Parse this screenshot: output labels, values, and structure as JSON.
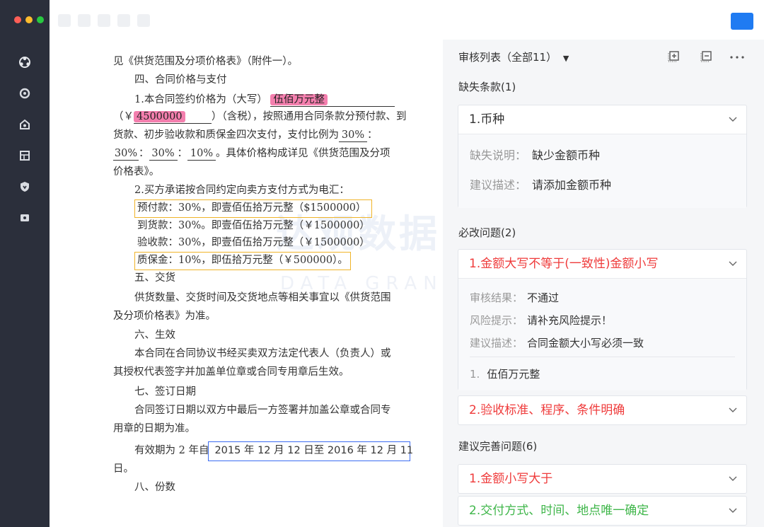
{
  "colors": {
    "sidebar": "#2b2f3b",
    "accent_blue": "#1f7bf2",
    "red": "#ef3b3b",
    "green": "#3fb64a",
    "highlight_pink": "#f47fae",
    "box_yellow": "#f0b429",
    "box_blue": "#3d6df2"
  },
  "sidebar": {
    "icons": [
      "logo-icon",
      "gear-icon",
      "home-icon",
      "layout-icon",
      "shield-icon",
      "document-icon"
    ]
  },
  "document": {
    "l1": "见《供货范围及分项价格表》（附件一）。",
    "l2": "四、合同价格与支付",
    "l3_pre": "1.本合同签约价格为（大写）",
    "l3_amount": "伍佰万元整",
    "l4_pre": "（￥",
    "l4_amount": "4500000",
    "l4_post": "）（含税），按照通用合同条款分预付款、到",
    "l5_pre": "货款、初步验收款和质保金四次支付，支付比例为",
    "l5_pct": "30%",
    "l5_post": "：",
    "l6_p1": "30%",
    "l6_s1": "：",
    "l6_p2": "30%",
    "l6_s2": "：",
    "l6_p3": "10%",
    "l6_post": "。具体价格构成详见《供货范围及分项",
    "l7": "价格表》。",
    "l8": "2.买方承诺按合同约定向卖方支付方式为电汇：",
    "l9": "预付款：30%，即壹佰伍拾万元整（$1500000）",
    "l10": "到货款：30%。即壹佰伍拾万元整（￥1500000）",
    "l11": "验收款：30%，即壹佰伍拾万元整（￥1500000）",
    "l12": "质保金：10%，即伍拾万元整（￥500000）。",
    "l13": "五、交货",
    "l14": "供货数量、交货时间及交货地点等相关事宜以《供货范围",
    "l15": "及分项价格表》为准。",
    "l16": "六、生效",
    "l17": "本合同在合同协议书经买卖双方法定代表人（负责人）或",
    "l18": "其授权代表签字并加盖单位章或合同专用章后生效。",
    "l19": "七、签订日期",
    "l20": "合同签订日期以双方中最后一方签署并加盖公章或合同专",
    "l21": "用章的日期为准。",
    "l22_pre": "有效期为 2 年自",
    "l22_date": "2015 年 12 月 12 日至 2016 年 12 月 11",
    "l23": "日。",
    "l24": "八、份数",
    "watermark": "达观数据",
    "watermark_en": "DATA GRAND"
  },
  "panel": {
    "title": "审核列表（全部11）",
    "missing": {
      "title": "缺失条款(1)",
      "item_title": "1.币种",
      "desc_label": "缺失说明：",
      "desc_value": "缺少金额币种",
      "suggest_label": "建议描述：",
      "suggest_value": "请添加金额币种"
    },
    "must_fix": {
      "title": "必改问题(2)",
      "item1_title": "1.金额大写不等于(一致性)金额小写",
      "result_label": "审核结果：",
      "result_value": "不通过",
      "risk_label": "风险提示：",
      "risk_value": "请补充风险提示！",
      "suggest_label": "建议描述：",
      "suggest_value": "合同金额大小写必须一致",
      "ref_index": "1.",
      "ref_text": "伍佰万元整",
      "item2_title": "2.验收标准、程序、条件明确"
    },
    "suggest": {
      "title": "建议完善问题(6)",
      "item1_title": "1.金额小写大于",
      "item2_title": "2.交付方式、时间、地点唯一确定"
    }
  }
}
